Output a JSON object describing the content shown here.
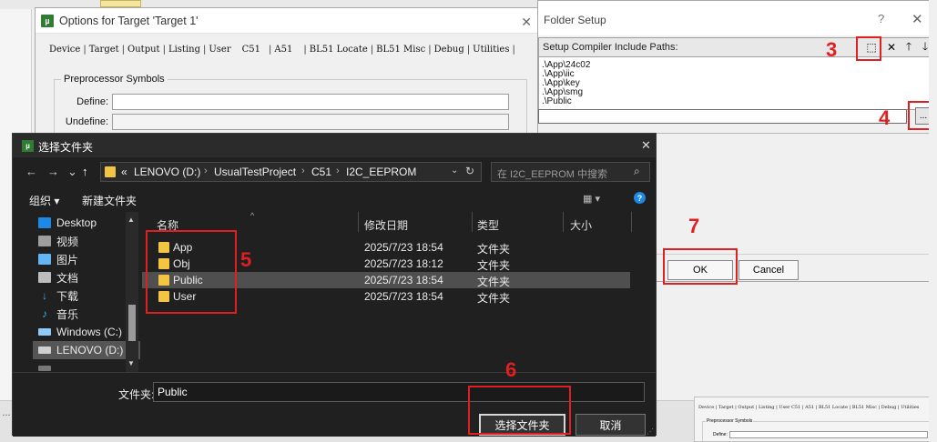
{
  "options_window": {
    "title": "Options for Target 'Target 1'",
    "close": "✕",
    "tabs": [
      "Device",
      "Target",
      "Output",
      "Listing",
      "User",
      "C51",
      "A51",
      "BL51 Locate",
      "BL51 Misc",
      "Debug",
      "Utilities"
    ],
    "group_label": "Preprocessor Symbols",
    "define_label": "Define:",
    "undefine_label": "Undefine:",
    "define_value": "",
    "undefine_value": ""
  },
  "folder_setup": {
    "title": "Folder Setup",
    "help": "?",
    "close": "✕",
    "header_label": "Setup Compiler Include Paths:",
    "toolbar": {
      "new": "⬚",
      "delete": "✕",
      "up": "🡑",
      "down": "🡓"
    },
    "paths": [
      ".\\App\\24c02",
      ".\\App\\iic",
      ".\\App\\key",
      ".\\App\\smg",
      ".\\Public"
    ],
    "edit_value": "",
    "browse_label": "...",
    "ok_label": "OK",
    "cancel_label": "Cancel"
  },
  "annotations": {
    "n3": "3",
    "n4": "4",
    "n5": "5",
    "n6": "6",
    "n7": "7",
    "color": "#e02020"
  },
  "chooser": {
    "title": "选择文件夹",
    "close": "✕",
    "nav": {
      "back": "←",
      "forward": "→",
      "up": "↑"
    },
    "breadcrumb": [
      "«",
      "LENOVO (D:)",
      "UsualTestProject",
      "C51",
      "I2C_EEPROM"
    ],
    "crumb_sep": "›",
    "dropdown": "⌄",
    "refresh": "↻",
    "search_placeholder": "在 I2C_EEPROM 中搜索",
    "search_icon": "⌕",
    "toolbar": {
      "organize": "组织 ▾",
      "new_folder": "新建文件夹",
      "view": "▦ ▾",
      "help": "?"
    },
    "nav_items": [
      {
        "label": "Desktop",
        "icon": "desktop-icon",
        "color": "#1e88e5"
      },
      {
        "label": "视频",
        "icon": "video-icon",
        "color": "#9e9e9e"
      },
      {
        "label": "图片",
        "icon": "pictures-icon",
        "color": "#64b5f6"
      },
      {
        "label": "文档",
        "icon": "documents-icon",
        "color": "#bdbdbd"
      },
      {
        "label": "下载",
        "icon": "download-icon",
        "color": "#42a5f5"
      },
      {
        "label": "音乐",
        "icon": "music-icon",
        "color": "#29b6f6"
      },
      {
        "label": "Windows (C:)",
        "icon": "drive-c-icon",
        "color": "#90caf9"
      },
      {
        "label": "LENOVO (D:)",
        "icon": "drive-d-icon",
        "color": "#cfcfcf"
      }
    ],
    "selected_nav": 7,
    "columns": {
      "name": "名称",
      "date": "修改日期",
      "type": "类型",
      "size": "大小"
    },
    "files": [
      {
        "name": "App",
        "date": "2025/7/23 18:54",
        "type": "文件夹"
      },
      {
        "name": "Obj",
        "date": "2025/7/23 18:12",
        "type": "文件夹"
      },
      {
        "name": "Public",
        "date": "2025/7/23 18:54",
        "type": "文件夹"
      },
      {
        "name": "User",
        "date": "2025/7/23 18:54",
        "type": "文件夹"
      }
    ],
    "selected_file": 2,
    "folder_label": "文件夹:",
    "folder_value": "Public",
    "select_button": "选择文件夹",
    "cancel_button": "取消"
  },
  "thumbnail": {
    "tabs": "Device | Target | Output | Listing | User    C51    | A51    | BL51 Locate | BL51 Misc | Debug | Utilities",
    "group": "Preprocessor Symbols",
    "define": "Define:"
  },
  "bottom_left": "..."
}
